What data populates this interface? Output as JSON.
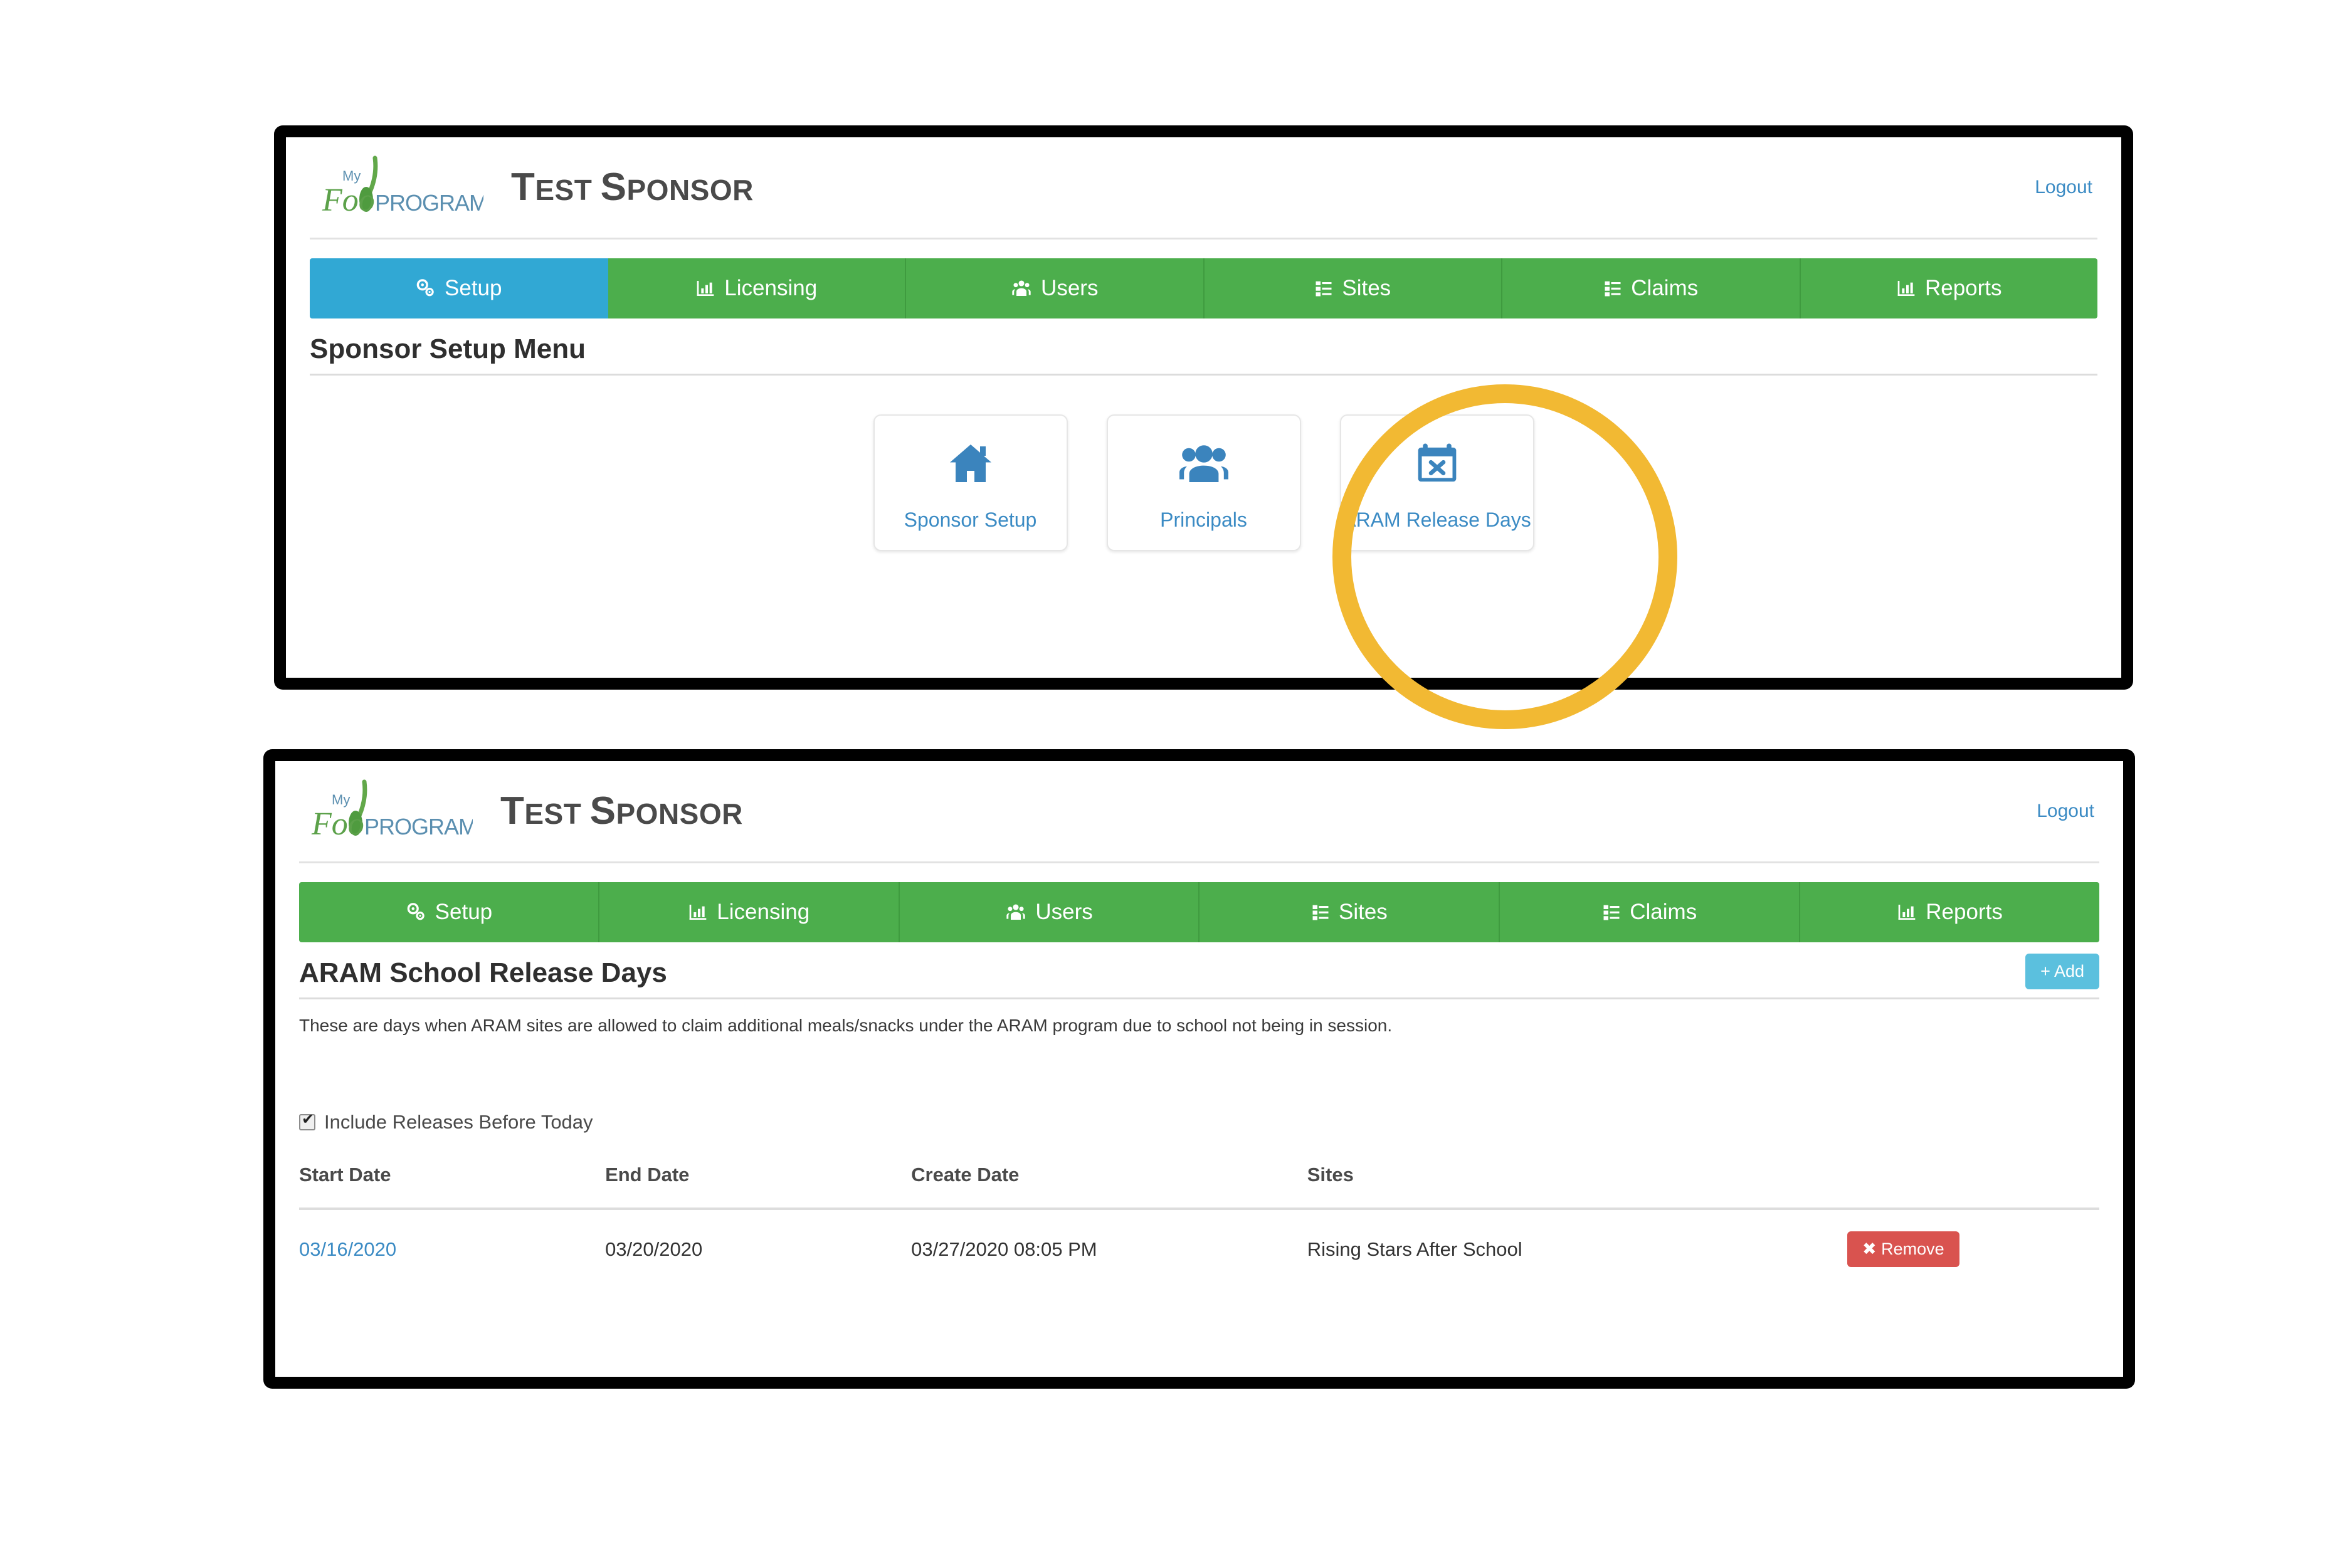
{
  "brand": {
    "logo_name": "my-food-program-logo",
    "logo_line1": "My",
    "logo_line2": "Food",
    "logo_line3": "PROGRAM",
    "green": "#5ca14a",
    "blue": "#5b8fb0"
  },
  "colors": {
    "tab_active": "#31a8d4",
    "tab_inactive": "#4cae4c",
    "link": "#3b8bc4",
    "add_button": "#5bc0de",
    "remove_button": "#d9534f",
    "highlight_ring": "#f2b933",
    "frame": "#000000"
  },
  "panel_top": {
    "header": {
      "sponsor_name_cap1": "T",
      "sponsor_name_rest1": "EST ",
      "sponsor_name_cap2": "S",
      "sponsor_name_rest2": "PONSOR",
      "logout_label": "Logout"
    },
    "tabs": [
      {
        "label": "Setup",
        "icon": "gears-icon",
        "active": true
      },
      {
        "label": "Licensing",
        "icon": "bar-chart-icon",
        "active": false
      },
      {
        "label": "Users",
        "icon": "users-icon",
        "active": false
      },
      {
        "label": "Sites",
        "icon": "list-icon",
        "active": false
      },
      {
        "label": "Claims",
        "icon": "list-icon",
        "active": false
      },
      {
        "label": "Reports",
        "icon": "bar-chart-icon",
        "active": false
      }
    ],
    "section_title": "Sponsor Setup Menu",
    "cards": [
      {
        "label": "Sponsor Setup",
        "icon": "home-icon"
      },
      {
        "label": "Principals",
        "icon": "users-group-icon"
      },
      {
        "label": "ARAM Release Days",
        "icon": "calendar-x-icon"
      }
    ]
  },
  "panel_bottom": {
    "header": {
      "sponsor_name_cap1": "T",
      "sponsor_name_rest1": "EST ",
      "sponsor_name_cap2": "S",
      "sponsor_name_rest2": "PONSOR",
      "logout_label": "Logout"
    },
    "tabs": [
      {
        "label": "Setup",
        "icon": "gears-icon",
        "active": false
      },
      {
        "label": "Licensing",
        "icon": "bar-chart-icon",
        "active": false
      },
      {
        "label": "Users",
        "icon": "users-icon",
        "active": false
      },
      {
        "label": "Sites",
        "icon": "list-icon",
        "active": false
      },
      {
        "label": "Claims",
        "icon": "list-icon",
        "active": false
      },
      {
        "label": "Reports",
        "icon": "bar-chart-icon",
        "active": false
      }
    ],
    "section_title": "ARAM School Release Days",
    "add_label": "+ Add",
    "description": "These are days when ARAM sites are allowed to claim additional meals/snacks under the ARAM program due to school not being in session.",
    "include_before_today": {
      "label": "Include Releases Before Today",
      "checked": true
    },
    "table": {
      "columns": [
        "Start Date",
        "End Date",
        "Create Date",
        "Sites",
        ""
      ],
      "rows": [
        {
          "start_date": "03/16/2020",
          "end_date": "03/20/2020",
          "create_date": "03/27/2020 08:05 PM",
          "sites": "Rising Stars After School",
          "action_label": "✖ Remove"
        }
      ]
    }
  },
  "annotation": {
    "highlight_target": "ARAM Release Days"
  }
}
